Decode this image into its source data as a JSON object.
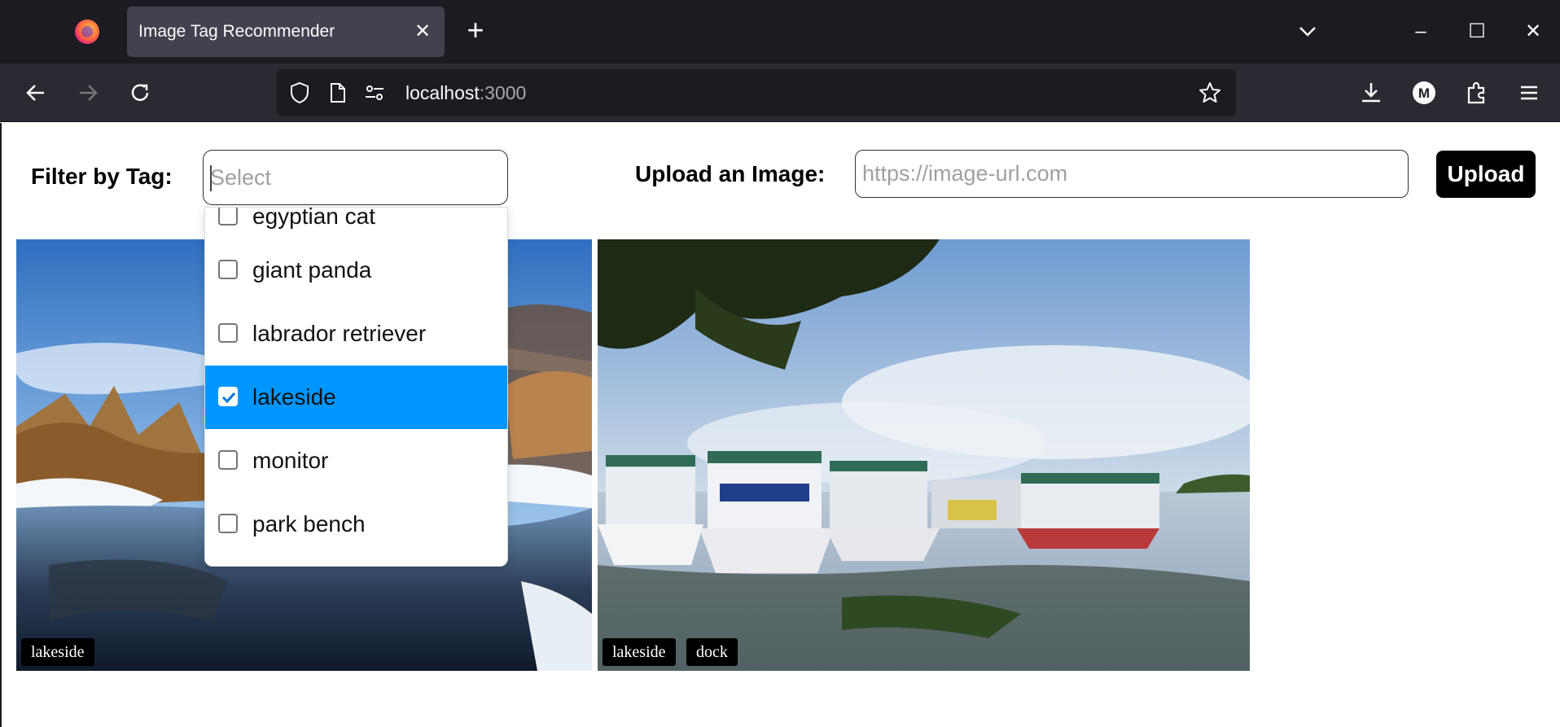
{
  "browser": {
    "tab_title": "Image Tag Recommender",
    "url_host": "localhost",
    "url_port": ":3000",
    "profile_initial": "M"
  },
  "filter": {
    "label": "Filter by Tag:",
    "placeholder": "Select",
    "options": [
      {
        "label": "egyptian cat",
        "checked": false
      },
      {
        "label": "giant panda",
        "checked": false
      },
      {
        "label": "labrador retriever",
        "checked": false
      },
      {
        "label": "lakeside",
        "checked": true
      },
      {
        "label": "monitor",
        "checked": false
      },
      {
        "label": "park bench",
        "checked": false
      }
    ]
  },
  "upload": {
    "label": "Upload an Image:",
    "placeholder": "https://image-url.com",
    "button_label": "Upload"
  },
  "images": [
    {
      "tags": [
        "lakeside"
      ]
    },
    {
      "tags": [
        "lakeside",
        "dock"
      ]
    }
  ],
  "colors": {
    "accent": "#0096ff",
    "tab_bg": "#42414d",
    "chrome_bg": "#1c1b22",
    "toolbar_bg": "#2b2a33"
  }
}
